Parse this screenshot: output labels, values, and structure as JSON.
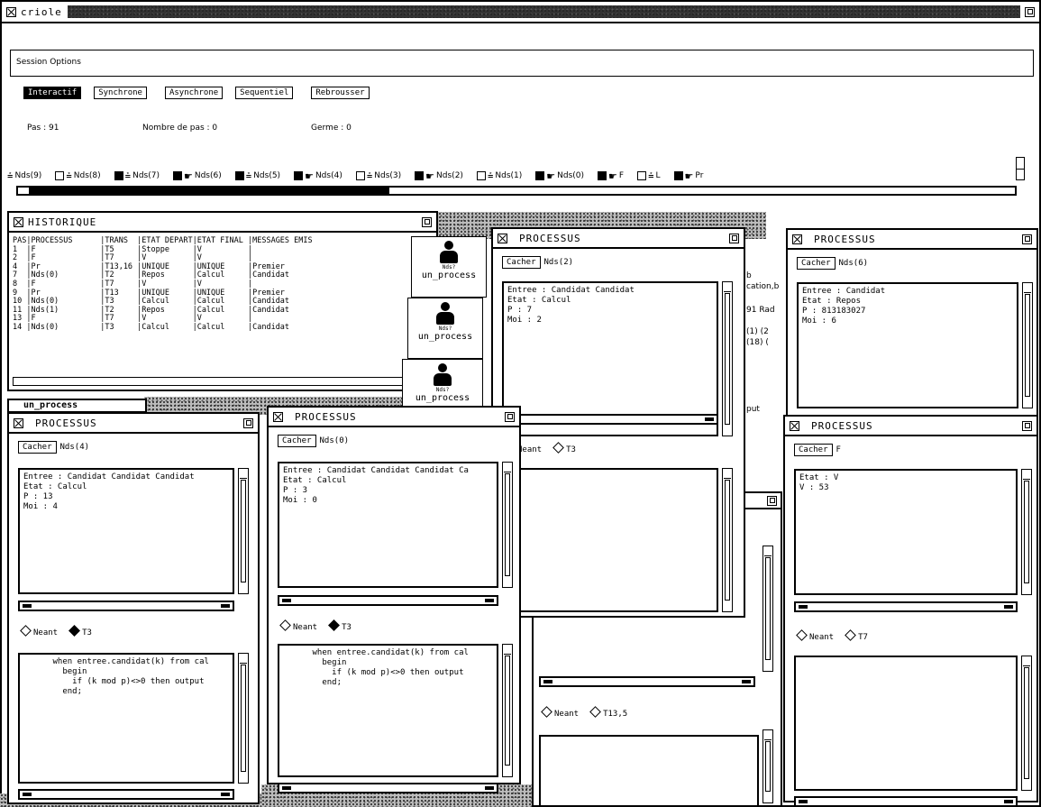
{
  "window": {
    "title": "criole"
  },
  "session_options_label": "Session Options",
  "mode_buttons": [
    "Interactif",
    "Synchrone",
    "Asynchrone",
    "Sequentiel",
    "Rebrousser"
  ],
  "stats": {
    "pas": "Pas : 91",
    "nombre_de_pas": "Nombre de pas : 0",
    "germe": "Germe : 0"
  },
  "nodes": [
    {
      "label": "Nds(9)",
      "kind": "tree",
      "marker": "none"
    },
    {
      "label": "Nds(8)",
      "kind": "tree",
      "marker": "open"
    },
    {
      "label": "Nds(7)",
      "kind": "tree",
      "marker": "filled"
    },
    {
      "label": "Nds(6)",
      "kind": "hand",
      "marker": "filled"
    },
    {
      "label": "Nds(5)",
      "kind": "tree",
      "marker": "filled"
    },
    {
      "label": "Nds(4)",
      "kind": "hand",
      "marker": "filled"
    },
    {
      "label": "Nds(3)",
      "kind": "tree",
      "marker": "open"
    },
    {
      "label": "Nds(2)",
      "kind": "hand",
      "marker": "filled"
    },
    {
      "label": "Nds(1)",
      "kind": "tree",
      "marker": "open"
    },
    {
      "label": "Nds(0)",
      "kind": "hand",
      "marker": "filled"
    },
    {
      "label": "F",
      "kind": "hand",
      "marker": "filled"
    },
    {
      "label": "L",
      "kind": "tree",
      "marker": "open"
    },
    {
      "label": "Pr",
      "kind": "hand",
      "marker": "filled"
    }
  ],
  "historique": {
    "title": "HISTORIQUE",
    "rows": [
      "PAS|PROCESSUS      |TRANS  |ETAT DEPART|ETAT FINAL |MESSAGES EMIS",
      "1  |F              |T5     |Stoppe     |V          |",
      "2  |F              |T7     |V          |V          |",
      "4  |Pr             |T13,16 |UNIQUE     |UNIQUE     |Premier",
      "7  |Nds(0)         |T2     |Repos      |Calcul     |Candidat",
      "8  |F              |T7     |V          |V          |",
      "9  |Pr             |T13    |UNIQUE     |UNIQUE     |Premier",
      "10 |Nds(0)         |T3     |Calcul     |Calcul     |Candidat",
      "11 |Nds(1)         |T2     |Repos      |Calcul     |Candidat",
      "13 |F              |T7     |V          |V          |",
      "14 |Nds(0)         |T3     |Calcul     |Calcul     |Candidat"
    ]
  },
  "icon_label": "un_process",
  "icon_badge": "Nds?",
  "partial_text": {
    "line1": "b",
    "line2": "cation,b",
    "line3": "91 Rad",
    "line4": "(1) (2",
    "line5": "(18) (",
    "line6": "put"
  },
  "processes": [
    {
      "title": "PROCESSUS",
      "cacher": "Cacher",
      "name": "Nds(2)",
      "vars": "Entree : Candidat Candidat\nEtat : Calcul\nP : 7\nMoi : 2",
      "r1": "Neant",
      "r2": "T3",
      "r2_on": false,
      "code": ""
    },
    {
      "title": "PROCESSUS",
      "cacher": "Cacher",
      "name": "Nds(6)",
      "vars": "Entree : Candidat\nEtat : Repos\nP : 813183027\nMoi : 6",
      "r1": "",
      "r2": "",
      "r2_on": false,
      "code": ""
    },
    {
      "title": "PROCESSUS",
      "cacher": "Cacher",
      "name": "Nds(4)",
      "vars": "Entree : Candidat Candidat Candidat\nEtat : Calcul\nP : 13\nMoi : 4",
      "r1": "Neant",
      "r2": "T3",
      "r2_on": true,
      "code": "      when entree.candidat(k) from cal\n        begin\n          if (k mod p)<>0 then output\n        end;"
    },
    {
      "title": "PROCESSUS",
      "cacher": "Cacher",
      "name": "Nds(0)",
      "vars": "Entree : Candidat Candidat Candidat Ca\nEtat : Calcul\nP : 3\nMoi : 0",
      "r1": "Neant",
      "r2": "T3",
      "r2_on": true,
      "code": "      when entree.candidat(k) from cal\n        begin\n          if (k mod p)<>0 then output\n        end;"
    },
    {
      "title": "PROCESSUS",
      "cacher": "Cacher",
      "name": "F",
      "vars": "Etat : V\nV : 53",
      "r1": "Neant",
      "r2": "T7",
      "r2_on": false,
      "code": ""
    }
  ],
  "partial_radio": {
    "r1": "Neant",
    "r2": "T13,5"
  }
}
